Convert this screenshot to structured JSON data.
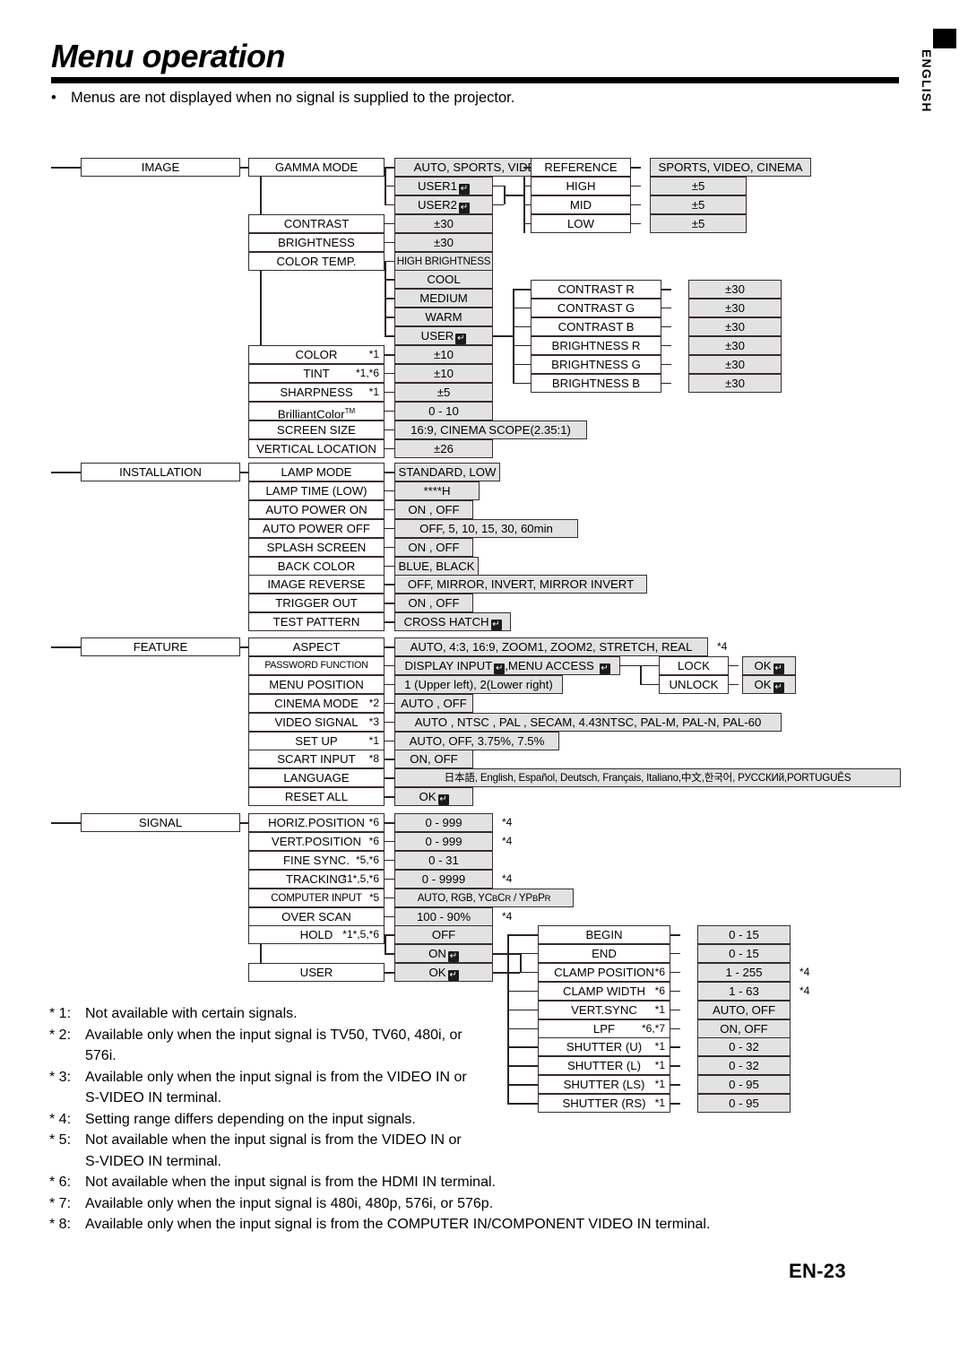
{
  "page": {
    "title": "Menu operation",
    "bullet": "Menus are not displayed when no signal is supplied to the projector.",
    "side_tab": "ENGLISH",
    "page_number": "EN-23"
  },
  "menu": {
    "image": {
      "root": "IMAGE",
      "items": [
        {
          "label": "GAMMA MODE",
          "value": "AUTO, SPORTS, VIDEO, CINEMA"
        },
        {
          "label": "",
          "value": "USER1"
        },
        {
          "label": "",
          "value": "USER2"
        },
        {
          "label": "CONTRAST",
          "value": "±30"
        },
        {
          "label": "BRIGHTNESS",
          "value": "±30"
        },
        {
          "label": "COLOR TEMP.",
          "value": "HIGH BRIGHTNESS"
        },
        {
          "label": "",
          "value": "COOL"
        },
        {
          "label": "",
          "value": "MEDIUM"
        },
        {
          "label": "",
          "value": "WARM"
        },
        {
          "label": "",
          "value": "USER"
        },
        {
          "label": "COLOR",
          "fn": "*1",
          "value": "±10"
        },
        {
          "label": "TINT",
          "fn": "*1,*6",
          "value": "±10"
        },
        {
          "label": "SHARPNESS",
          "fn": "*1",
          "value": "±5"
        },
        {
          "label": "BrilliantColor",
          "sup": "TM",
          "value": "0 - 10"
        },
        {
          "label": "SCREEN SIZE",
          "value": "16:9, CINEMA SCOPE(2.35:1)"
        },
        {
          "label": "VERTICAL LOCATION",
          "value": "±26"
        }
      ],
      "gamma_user": [
        {
          "label": "REFERENCE",
          "value": "SPORTS, VIDEO, CINEMA"
        },
        {
          "label": "HIGH",
          "value": "±5"
        },
        {
          "label": "MID",
          "value": "±5"
        },
        {
          "label": "LOW",
          "value": "±5"
        }
      ],
      "color_user": [
        {
          "label": "CONTRAST R",
          "value": "±30"
        },
        {
          "label": "CONTRAST G",
          "value": "±30"
        },
        {
          "label": "CONTRAST B",
          "value": "±30"
        },
        {
          "label": "BRIGHTNESS R",
          "value": "±30"
        },
        {
          "label": "BRIGHTNESS G",
          "value": "±30"
        },
        {
          "label": "BRIGHTNESS B",
          "value": "±30"
        }
      ]
    },
    "installation": {
      "root": "INSTALLATION",
      "items": [
        {
          "label": "LAMP MODE",
          "value": "STANDARD, LOW"
        },
        {
          "label": "LAMP TIME (LOW)",
          "value": "****H"
        },
        {
          "label": "AUTO POWER ON",
          "value": "ON , OFF"
        },
        {
          "label": "AUTO POWER OFF",
          "value": "OFF, 5, 10, 15, 30, 60min"
        },
        {
          "label": "SPLASH SCREEN",
          "value": "ON , OFF"
        },
        {
          "label": "BACK COLOR",
          "value": "BLUE, BLACK"
        },
        {
          "label": "IMAGE REVERSE",
          "value": "OFF, MIRROR, INVERT, MIRROR INVERT"
        },
        {
          "label": "TRIGGER OUT",
          "value": "ON , OFF"
        },
        {
          "label": "TEST PATTERN",
          "value": "CROSS HATCH"
        }
      ]
    },
    "feature": {
      "root": "FEATURE",
      "items": [
        {
          "label": "ASPECT",
          "value": "AUTO, 4:3, 16:9, ZOOM1, ZOOM2, STRETCH, REAL",
          "note": "*4"
        },
        {
          "label": "PASSWORD FUNCTION",
          "value": "DISPLAY INPUT ,MENU ACCESS "
        },
        {
          "label": "MENU POSITION",
          "value": "1 (Upper left), 2(Lower right)"
        },
        {
          "label": "CINEMA MODE",
          "fn": "*2",
          "value": "AUTO , OFF"
        },
        {
          "label": "VIDEO SIGNAL",
          "fn": "*3",
          "value": "AUTO , NTSC , PAL , SECAM, 4.43NTSC, PAL-M, PAL-N, PAL-60"
        },
        {
          "label": "SET UP",
          "fn": "*1",
          "value": "AUTO, OFF, 3.75%, 7.5%"
        },
        {
          "label": "SCART INPUT",
          "fn": "*8",
          "value": "ON, OFF"
        },
        {
          "label": "LANGUAGE",
          "value": "日本語, English, Español, Deutsch, Français, Italiano,中文,한국어, РУССКИй,PORTUGUÊS"
        },
        {
          "label": "RESET ALL",
          "value": "OK"
        }
      ],
      "password": [
        {
          "label": "LOCK",
          "value": "OK"
        },
        {
          "label": "UNLOCK",
          "value": "OK"
        }
      ]
    },
    "signal": {
      "root": "SIGNAL",
      "items": [
        {
          "label": "HORIZ.POSITION",
          "fn": "*6",
          "value": "0 - 999",
          "note": "*4"
        },
        {
          "label": "VERT.POSITION",
          "fn": "*6",
          "value": "0 - 999",
          "note": "*4"
        },
        {
          "label": "FINE SYNC.",
          "fn": "*5,*6",
          "value": "0 - 31"
        },
        {
          "label": "TRACKING",
          "fn": "*1*,5,*6",
          "value": "0 - 9999",
          "note": "*4"
        },
        {
          "label": "COMPUTER INPUT",
          "fn": "*5",
          "value": "AUTO, RGB, YCBCR / YPBPR"
        },
        {
          "label": "OVER SCAN",
          "value": "100 - 90%",
          "note": "*4"
        },
        {
          "label": "HOLD",
          "fn": "*1*,5,*6",
          "value": "OFF"
        },
        {
          "label": "",
          "value": "ON"
        },
        {
          "label": "USER",
          "value": "OK"
        }
      ],
      "user_sub": [
        {
          "label": "BEGIN",
          "value": "0 - 15"
        },
        {
          "label": "END",
          "value": "0 - 15"
        },
        {
          "label": "CLAMP POSITION",
          "fn": "*6",
          "value": "1 - 255",
          "note": "*4"
        },
        {
          "label": "CLAMP WIDTH",
          "fn": "*6",
          "value": "1 - 63",
          "note": "*4"
        },
        {
          "label": "VERT.SYNC",
          "fn": "*1",
          "value": "AUTO, OFF"
        },
        {
          "label": "LPF",
          "fn": "*6,*7",
          "value": "ON, OFF"
        },
        {
          "label": "SHUTTER (U)",
          "fn": "*1",
          "value": "0 - 32"
        },
        {
          "label": "SHUTTER (L)",
          "fn": "*1",
          "value": "0 - 32"
        },
        {
          "label": "SHUTTER (LS)",
          "fn": "*1",
          "value": "0 - 95"
        },
        {
          "label": "SHUTTER (RS)",
          "fn": "*1",
          "value": "0 - 95"
        }
      ]
    }
  },
  "footnotes": [
    {
      "mark": "* 1:",
      "text": "Not available with certain signals."
    },
    {
      "mark": "* 2:",
      "text": "Available only when the input signal is TV50, TV60, 480i, or",
      "cont": "576i."
    },
    {
      "mark": "* 3:",
      "text": "Available only when the input signal is from the VIDEO IN or",
      "cont": "S-VIDEO IN terminal."
    },
    {
      "mark": "* 4:",
      "text": "Setting range differs depending on the input signals."
    },
    {
      "mark": "* 5:",
      "text": "Not available when the input signal is from the VIDEO IN or",
      "cont": "S-VIDEO IN terminal."
    },
    {
      "mark": "* 6:",
      "text": "Not available when the input signal is from the HDMI IN terminal."
    },
    {
      "mark": "* 7:",
      "text": "Available only when the input signal is 480i, 480p, 576i, or 576p."
    },
    {
      "mark": "* 8:",
      "text": "Available only when the input signal is from the COMPUTER IN/COMPONENT VIDEO IN terminal."
    }
  ]
}
